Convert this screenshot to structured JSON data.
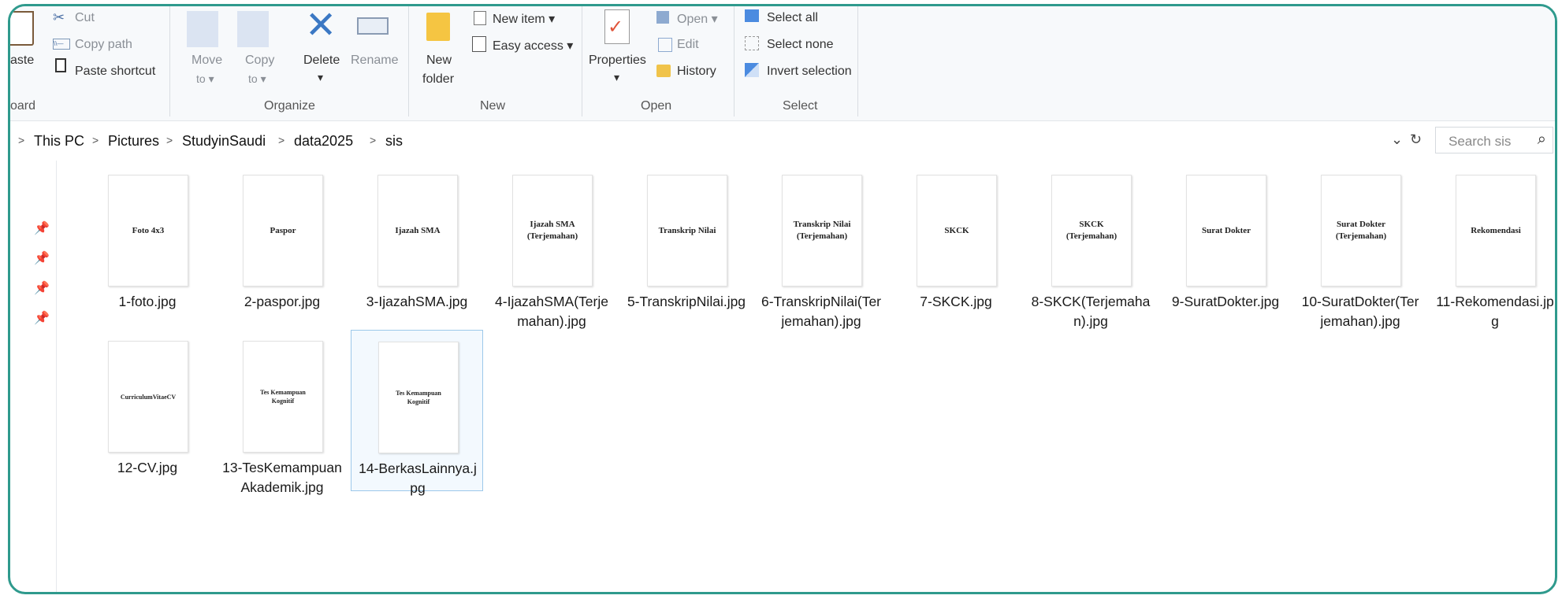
{
  "ribbon": {
    "clipboard": {
      "paste": "aste",
      "cut": "Cut",
      "copy_path": "Copy path",
      "paste_shortcut": "Paste shortcut",
      "label": "oard"
    },
    "organize": {
      "move_to": "Move",
      "move_to_2": "to ▾",
      "copy_to": "Copy",
      "copy_to_2": "to ▾",
      "delete": "Delete",
      "delete_2": "▾",
      "rename": "Rename",
      "label": "Organize"
    },
    "new": {
      "new_folder": "New",
      "new_folder_2": "folder",
      "new_item": "New item ▾",
      "easy_access": "Easy access ▾",
      "label": "New"
    },
    "open": {
      "properties": "Properties",
      "properties_2": "▾",
      "open": "Open ▾",
      "edit": "Edit",
      "history": "History",
      "label": "Open"
    },
    "select": {
      "select_all": "Select all",
      "select_none": "Select none",
      "invert_selection": "Invert selection",
      "label": "Select"
    }
  },
  "address": {
    "crumbs": [
      "This PC",
      "Pictures",
      "StudyinSaudi",
      "data2025",
      "sis"
    ],
    "search_placeholder": "Search sis"
  },
  "files": [
    {
      "name": "1-foto.jpg",
      "doc": "Foto 4x3"
    },
    {
      "name": "2-paspor.jpg",
      "doc": "Paspor"
    },
    {
      "name": "3-IjazahSMA.jpg",
      "doc": "Ijazah SMA"
    },
    {
      "name": "4-IjazahSMA(Terjemahan).jpg",
      "doc": "Ijazah SMA\n(Terjemahan)"
    },
    {
      "name": "5-TranskripNilai.jpg",
      "doc": "Transkrip Nilai"
    },
    {
      "name": "6-TranskripNilai(Terjemahan).jpg",
      "doc": "Transkrip Nilai\n(Terjemahan)"
    },
    {
      "name": "7-SKCK.jpg",
      "doc": "SKCK"
    },
    {
      "name": "8-SKCK(Terjemahan).jpg",
      "doc": "SKCK\n(Terjemahan)"
    },
    {
      "name": "9-SuratDokter.jpg",
      "doc": "Surat Dokter"
    },
    {
      "name": "10-SuratDokter(Terjemahan).jpg",
      "doc": "Surat Dokter\n(Terjemahan)"
    },
    {
      "name": "11-Rekomendasi.jpg",
      "doc": "Rekomendasi"
    },
    {
      "name": "12-CV.jpg",
      "doc": "CurriculumVitaeCV"
    },
    {
      "name": "13-TesKemampuanAkademik.jpg",
      "doc": "Tes Kemampuan\nKognitif"
    },
    {
      "name": "14-BerkasLainnya.jpg",
      "doc": "Tes Kemampuan\nKognitif"
    }
  ],
  "colors": {
    "frame": "#2f9a8d",
    "selection_border": "#9cc8ea",
    "selection_bg": "#f3f9fe",
    "delete_x": "#3b78c4",
    "properties_check": "#e0543a"
  }
}
